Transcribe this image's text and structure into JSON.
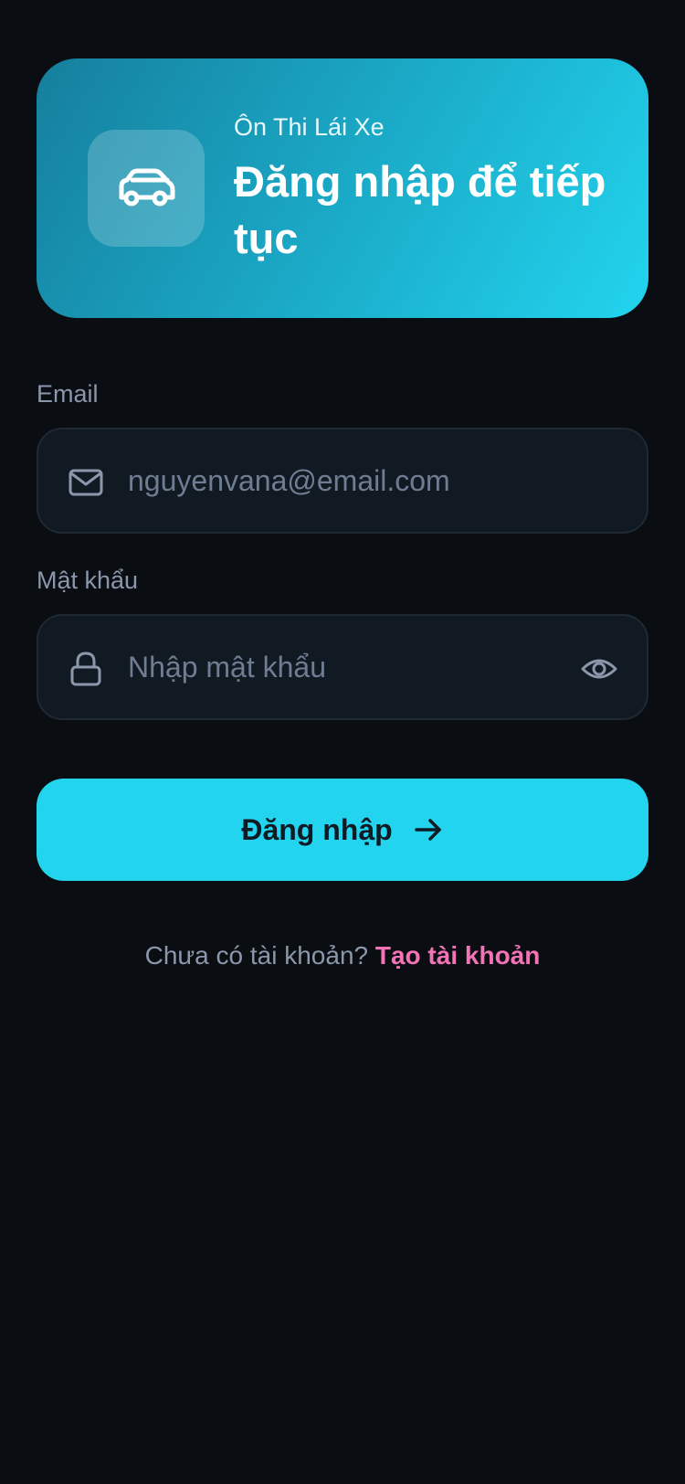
{
  "header": {
    "app_name": "Ôn Thi Lái Xe",
    "title": "Đăng nhập để tiếp tục",
    "icon": "car-icon"
  },
  "form": {
    "email": {
      "label": "Email",
      "value": "",
      "placeholder": "nguyenvana@email.com",
      "icon": "mail-icon"
    },
    "password": {
      "label": "Mật khẩu",
      "value": "",
      "placeholder": "Nhập mật khẩu",
      "icon": "lock-icon",
      "toggle_icon": "eye-icon"
    },
    "submit": {
      "label": "Đăng nhập",
      "icon": "arrow-right-icon"
    }
  },
  "footer": {
    "prompt": "Chưa có tài khoản?",
    "link": "Tạo tài khoản"
  },
  "colors": {
    "background": "#0a0d12",
    "accent": "#22d4ee",
    "link": "#f472b6",
    "input_bg": "#111923"
  }
}
